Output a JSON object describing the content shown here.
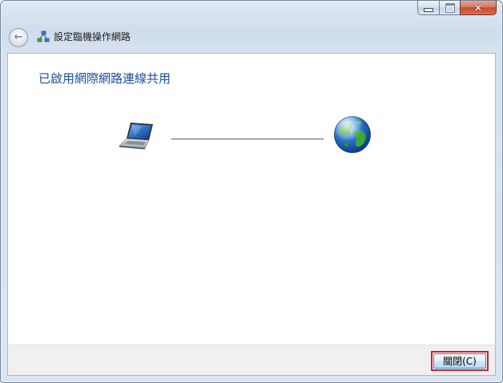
{
  "window": {
    "caption_buttons": {
      "close_glyph": "✕"
    }
  },
  "nav": {
    "back_icon": "back-arrow-icon",
    "title": "設定臨機操作網路"
  },
  "main": {
    "heading": "已啟用網際網路連線共用",
    "diagram": {
      "left_icon": "laptop-icon",
      "right_icon": "globe-icon"
    }
  },
  "footer": {
    "close_label": "關閉(C)"
  },
  "colors": {
    "heading": "#1e4c9a",
    "focus_highlight": "#d21f2b"
  }
}
